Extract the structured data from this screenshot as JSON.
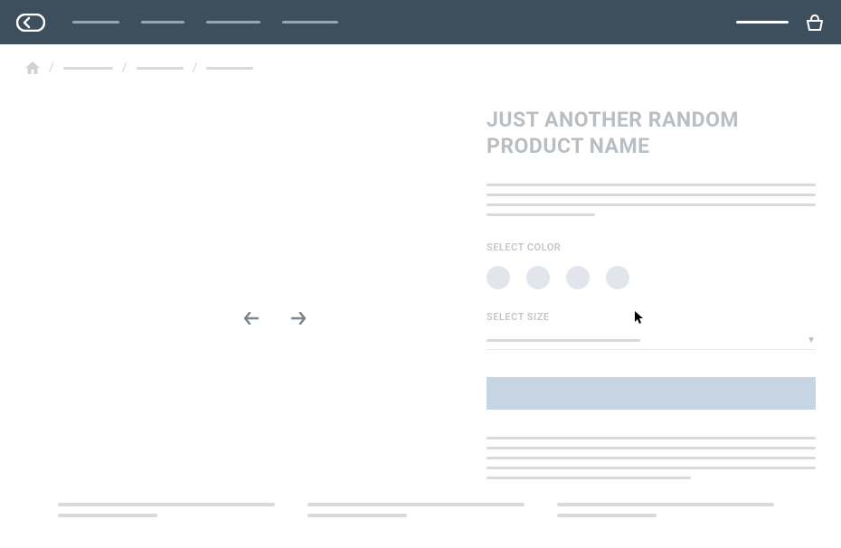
{
  "header": {
    "nav_items": [
      "",
      "",
      "",
      ""
    ],
    "basket_label": ""
  },
  "breadcrumb": {
    "crumbs": [
      "",
      "",
      ""
    ]
  },
  "product": {
    "title": "JUST ANOTHER RANDOM PRODUCT NAME",
    "select_color_label": "SELECT COLOR",
    "select_size_label": "SELECT SIZE",
    "color_options": [
      "",
      "",
      "",
      ""
    ],
    "add_to_cart_label": ""
  },
  "thumbnails": [
    "",
    "",
    ""
  ]
}
